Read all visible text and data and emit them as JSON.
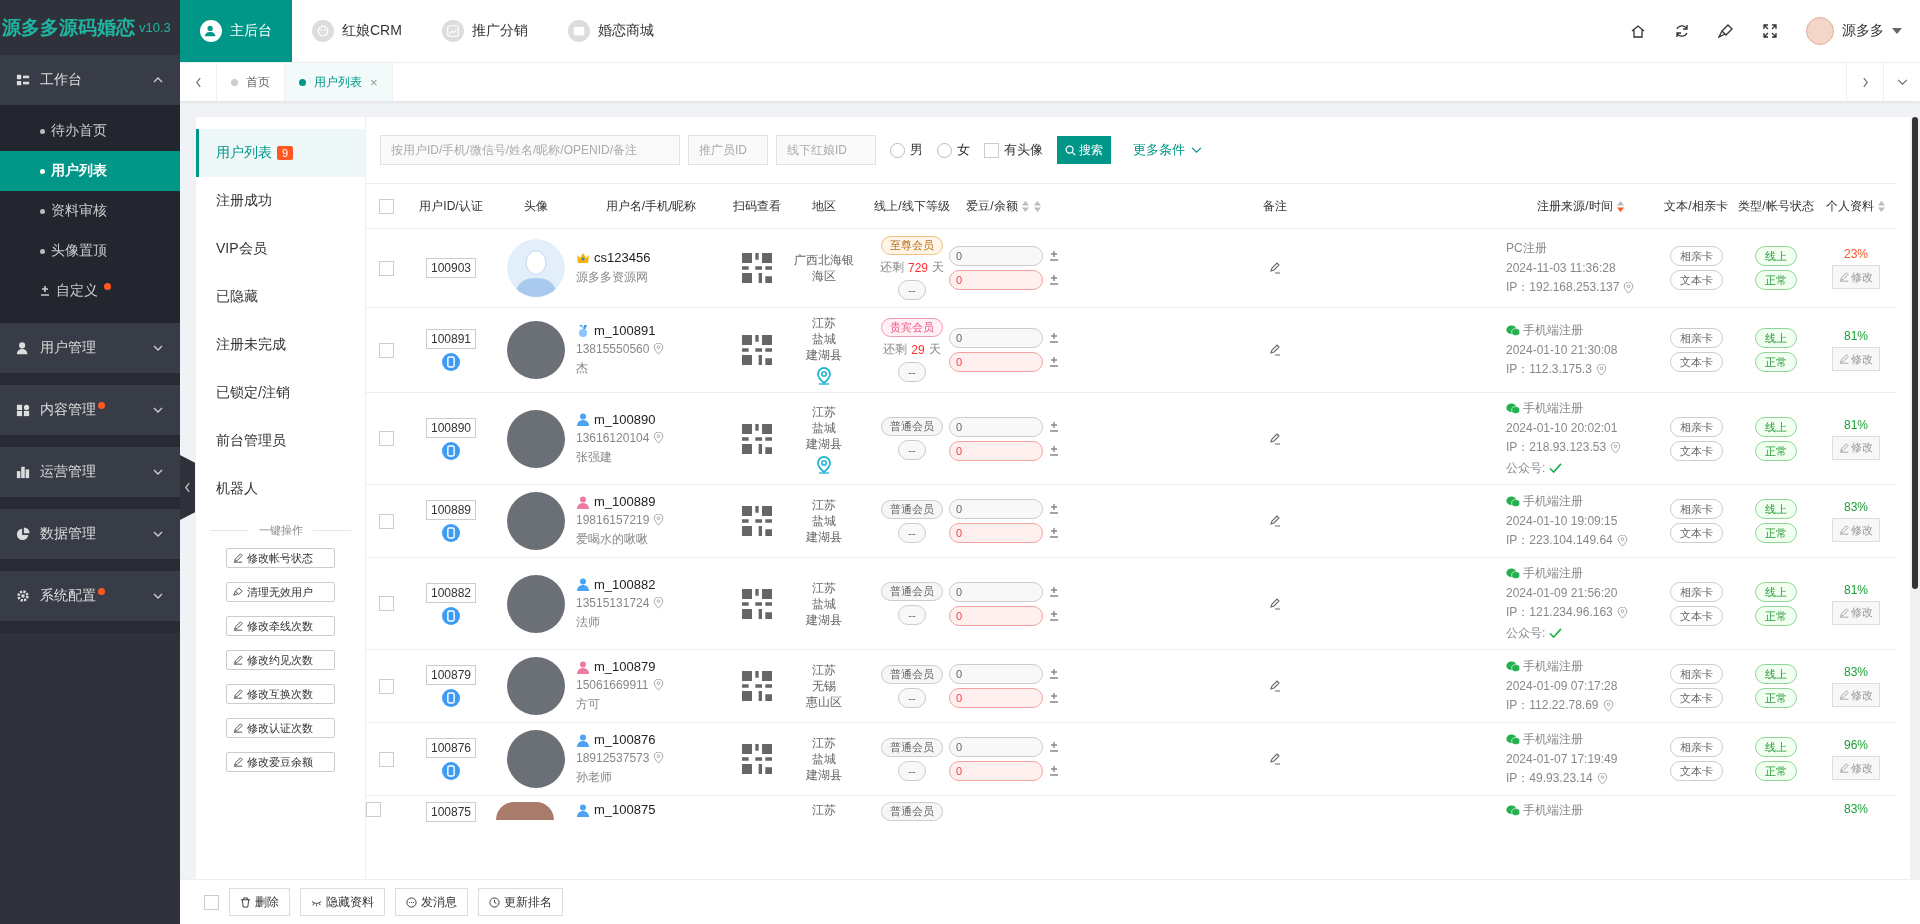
{
  "logo": {
    "name": "源多多源码婚恋",
    "version": "v10.3"
  },
  "sidebar": {
    "groups": [
      {
        "label": "工作台",
        "expanded": true,
        "dot": false,
        "children": [
          {
            "label": "待办首页",
            "selected": false,
            "kind": "page",
            "dot": false
          },
          {
            "label": "用户列表",
            "selected": true,
            "kind": "page",
            "dot": false
          },
          {
            "label": "资料审核",
            "selected": false,
            "kind": "page",
            "dot": false
          },
          {
            "label": "头像置顶",
            "selected": false,
            "kind": "page",
            "dot": false
          },
          {
            "label": "自定义",
            "selected": false,
            "kind": "custom",
            "dot": true
          }
        ]
      },
      {
        "label": "用户管理",
        "expanded": false,
        "dot": false
      },
      {
        "label": "内容管理",
        "expanded": false,
        "dot": true
      },
      {
        "label": "运营管理",
        "expanded": false,
        "dot": false
      },
      {
        "label": "数据管理",
        "expanded": false,
        "dot": false
      },
      {
        "label": "系统配置",
        "expanded": false,
        "dot": true
      }
    ]
  },
  "top_nav": [
    {
      "label": "主后台",
      "selected": true
    },
    {
      "label": "红娘CRM",
      "selected": false
    },
    {
      "label": "推广分销",
      "selected": false
    },
    {
      "label": "婚恋商城",
      "selected": false
    }
  ],
  "user_menu": {
    "name": "源多多"
  },
  "tabs": [
    {
      "label": "首页",
      "selected": false,
      "closable": false
    },
    {
      "label": "用户列表",
      "selected": true,
      "closable": true
    }
  ],
  "close_glyph": "×",
  "subnav": {
    "items": [
      {
        "label": "用户列表",
        "selected": true,
        "count": "9"
      },
      {
        "label": "注册成功",
        "selected": false
      },
      {
        "label": "VIP会员",
        "selected": false
      },
      {
        "label": "已隐藏",
        "selected": false
      },
      {
        "label": "注册未完成",
        "selected": false
      },
      {
        "label": "已锁定/注销",
        "selected": false
      },
      {
        "label": "前台管理员",
        "selected": false
      },
      {
        "label": "机器人",
        "selected": false
      }
    ],
    "actions_title": "一键操作",
    "actions": [
      {
        "label": "修改帐号状态",
        "kind": "edit"
      },
      {
        "label": "清理无效用户",
        "kind": "clean"
      },
      {
        "label": "修改牵线次数",
        "kind": "edit"
      },
      {
        "label": "修改约见次数",
        "kind": "edit"
      },
      {
        "label": "修改互换次数",
        "kind": "edit"
      },
      {
        "label": "修改认证次数",
        "kind": "edit"
      },
      {
        "label": "修改爱豆余额",
        "kind": "edit"
      }
    ]
  },
  "filters": {
    "keyword": {
      "placeholder": "按用户ID/手机/微信号/姓名/昵称/OPENID/备注"
    },
    "promoter": {
      "placeholder": "推广员ID"
    },
    "matchmaker": {
      "placeholder": "线下红娘ID"
    },
    "gender": [
      {
        "label": "男",
        "selected": false
      },
      {
        "label": "女",
        "selected": false
      }
    ],
    "has_avatar": {
      "label": "有头像",
      "checked": false
    },
    "search_button": "搜索",
    "more": "更多条件"
  },
  "table": {
    "all_checked": false,
    "columns": [
      {
        "label": "用户ID/认证"
      },
      {
        "label": "头像"
      },
      {
        "label": "用户名/手机/昵称"
      },
      {
        "label": "扫码查看"
      },
      {
        "label": "地区"
      },
      {
        "label": "线上/线下等级"
      },
      {
        "label": "爱豆/余额",
        "sorts": [
          {
            "active": false
          },
          {
            "active": false
          }
        ]
      },
      {
        "label": "备注"
      },
      {
        "label": "注册来源/时间",
        "sorts": [
          {
            "active": true
          }
        ]
      },
      {
        "label": "文本/相亲卡"
      },
      {
        "label": "类型/帐号状态"
      },
      {
        "label": "个人资料",
        "sorts": [
          {
            "active": false
          }
        ]
      }
    ],
    "rows": [
      {
        "checked": false,
        "id": "100903",
        "verified": false,
        "avatar": {
          "kind": "default"
        },
        "badge": {
          "kind": "crown"
        },
        "name": "cs123456",
        "nickname": "源多多资源网",
        "region": [
          "广西北海银",
          "海区"
        ],
        "region_pin": false,
        "level": {
          "kind": "supreme",
          "label": "至尊会员"
        },
        "remaining": {
          "before": "还剩",
          "days": "729",
          "after": "天"
        },
        "offline_level": "--",
        "beans": "0",
        "balance": "0",
        "source": {
          "kind": "pc",
          "label": "PC注册",
          "time": "2024-11-03 11:36:28",
          "ip": "IP：192.168.253.137"
        },
        "cards": [
          "相亲卡",
          "文本卡"
        ],
        "status": [
          "线上",
          "正常"
        ],
        "profile": {
          "percent": "23%",
          "color": "#ff5722",
          "edit": "修改"
        }
      },
      {
        "checked": false,
        "id": "100891",
        "verified": true,
        "avatar": {
          "kind": "photo"
        },
        "badge": {
          "kind": "medal"
        },
        "name": "m_100891",
        "phone": "13815550560",
        "nickname": "杰",
        "region": [
          "江苏",
          "盐城",
          "建湖县"
        ],
        "region_pin": true,
        "level": {
          "kind": "vip",
          "label": "贵宾会员"
        },
        "remaining": {
          "before": "还剩",
          "days": "29",
          "after": "天"
        },
        "offline_level": "--",
        "beans": "0",
        "balance": "0",
        "source": {
          "kind": "wechat",
          "label": "手机端注册",
          "time": "2024-01-10 21:30:08",
          "ip": "IP：112.3.175.3"
        },
        "cards": [
          "相亲卡",
          "文本卡"
        ],
        "status": [
          "线上",
          "正常"
        ],
        "profile": {
          "percent": "81%",
          "color": "#1aa034",
          "edit": "修改"
        }
      },
      {
        "checked": false,
        "id": "100890",
        "verified": true,
        "avatar": {
          "kind": "photo"
        },
        "badge": {
          "kind": "male"
        },
        "name": "m_100890",
        "phone": "13616120104",
        "nickname": "张强建",
        "region": [
          "江苏",
          "盐城",
          "建湖县"
        ],
        "region_pin": true,
        "level": {
          "kind": "normal",
          "label": "普通会员"
        },
        "offline_level": "--",
        "beans": "0",
        "balance": "0",
        "source": {
          "kind": "wechat",
          "label": "手机端注册",
          "time": "2024-01-10 20:02:01",
          "ip": "IP：218.93.123.53",
          "official": "公众号:"
        },
        "cards": [
          "相亲卡",
          "文本卡"
        ],
        "status": [
          "线上",
          "正常"
        ],
        "profile": {
          "percent": "81%",
          "color": "#1aa034",
          "edit": "修改"
        }
      },
      {
        "checked": false,
        "id": "100889",
        "verified": true,
        "avatar": {
          "kind": "photo"
        },
        "badge": {
          "kind": "female"
        },
        "name": "m_100889",
        "phone": "19816157219",
        "nickname": "爱喝水的啾啾",
        "region": [
          "江苏",
          "盐城",
          "建湖县"
        ],
        "region_pin": false,
        "level": {
          "kind": "normal",
          "label": "普通会员"
        },
        "offline_level": "--",
        "beans": "0",
        "balance": "0",
        "source": {
          "kind": "wechat",
          "label": "手机端注册",
          "time": "2024-01-10 19:09:15",
          "ip": "IP：223.104.149.64"
        },
        "cards": [
          "相亲卡",
          "文本卡"
        ],
        "status": [
          "线上",
          "正常"
        ],
        "profile": {
          "percent": "83%",
          "color": "#1aa034",
          "edit": "修改"
        }
      },
      {
        "checked": false,
        "id": "100882",
        "verified": true,
        "avatar": {
          "kind": "photo"
        },
        "badge": {
          "kind": "male"
        },
        "name": "m_100882",
        "phone": "13515131724",
        "nickname": "法师",
        "region": [
          "江苏",
          "盐城",
          "建湖县"
        ],
        "region_pin": false,
        "level": {
          "kind": "normal",
          "label": "普通会员"
        },
        "offline_level": "--",
        "beans": "0",
        "balance": "0",
        "source": {
          "kind": "wechat",
          "label": "手机端注册",
          "time": "2024-01-09 21:56:20",
          "ip": "IP：121.234.96.163",
          "official": "公众号:"
        },
        "cards": [
          "相亲卡",
          "文本卡"
        ],
        "status": [
          "线上",
          "正常"
        ],
        "profile": {
          "percent": "81%",
          "color": "#1aa034",
          "edit": "修改"
        }
      },
      {
        "checked": false,
        "id": "100879",
        "verified": true,
        "avatar": {
          "kind": "photo"
        },
        "badge": {
          "kind": "female"
        },
        "name": "m_100879",
        "phone": "15061669911",
        "nickname": "方可",
        "region": [
          "江苏",
          "无锡",
          "惠山区"
        ],
        "region_pin": false,
        "level": {
          "kind": "normal",
          "label": "普通会员"
        },
        "offline_level": "--",
        "beans": "0",
        "balance": "0",
        "source": {
          "kind": "wechat",
          "label": "手机端注册",
          "time": "2024-01-09 07:17:28",
          "ip": "IP：112.22.78.69"
        },
        "cards": [
          "相亲卡",
          "文本卡"
        ],
        "status": [
          "线上",
          "正常"
        ],
        "profile": {
          "percent": "83%",
          "color": "#1aa034",
          "edit": "修改"
        }
      },
      {
        "checked": false,
        "id": "100876",
        "verified": true,
        "avatar": {
          "kind": "photo"
        },
        "badge": {
          "kind": "male"
        },
        "name": "m_100876",
        "phone": "18912537573",
        "nickname": "孙老师",
        "region": [
          "江苏",
          "盐城",
          "建湖县"
        ],
        "region_pin": false,
        "level": {
          "kind": "normal",
          "label": "普通会员"
        },
        "offline_level": "--",
        "beans": "0",
        "balance": "0",
        "source": {
          "kind": "wechat",
          "label": "手机端注册",
          "time": "2024-01-07 17:19:49",
          "ip": "IP：49.93.23.14"
        },
        "cards": [
          "相亲卡",
          "文本卡"
        ],
        "status": [
          "线上",
          "正常"
        ],
        "profile": {
          "percent": "96%",
          "color": "#1aa034",
          "edit": "修改"
        }
      },
      {
        "checked": false,
        "id": "100875",
        "avatar": {
          "kind": "photo"
        },
        "badge": {
          "kind": "male"
        },
        "name": "m_100875",
        "region": [
          "江苏"
        ],
        "level": {
          "kind": "normal",
          "label": "普通会员"
        },
        "source": {
          "kind": "wechat",
          "label": "手机端注册"
        },
        "profile": {
          "percent": "83%",
          "color": "#1aa034"
        }
      }
    ]
  },
  "bottom_bar": {
    "all_checked": false,
    "buttons": [
      {
        "label": "删除"
      },
      {
        "label": "隐藏资料"
      },
      {
        "label": "发消息"
      },
      {
        "label": "更新排名"
      }
    ]
  }
}
